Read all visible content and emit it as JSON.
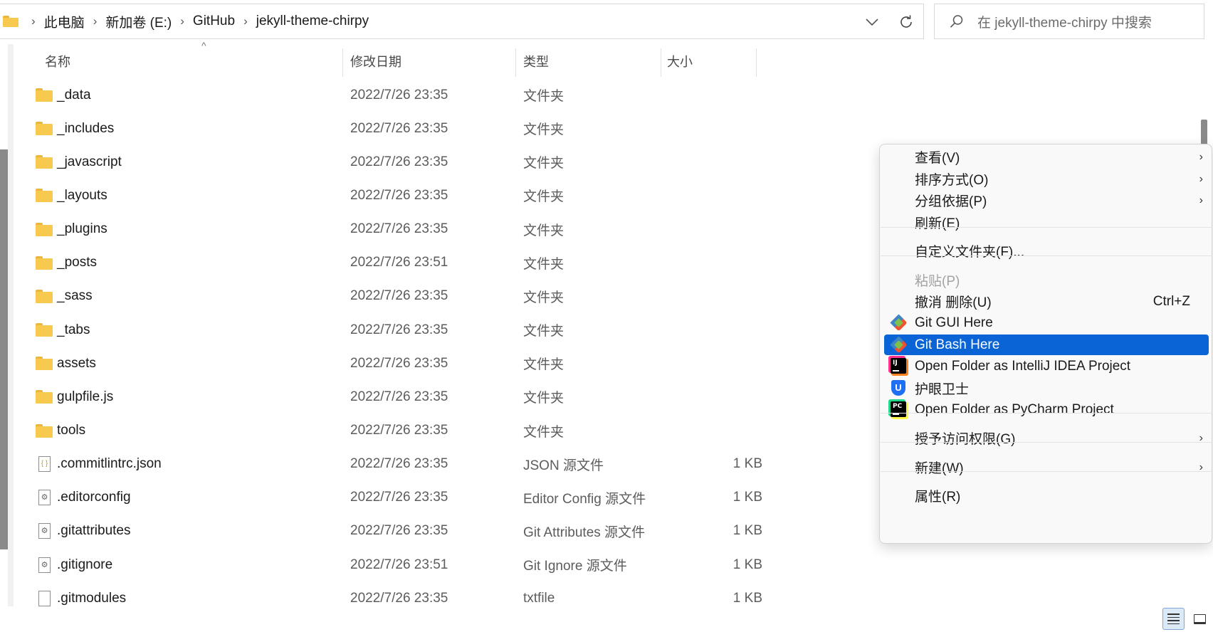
{
  "address_bar": {
    "crumbs": [
      "此电脑",
      "新加卷 (E:)",
      "GitHub",
      "jekyll-theme-chirpy"
    ],
    "separator": "›"
  },
  "search": {
    "placeholder": "在 jekyll-theme-chirpy 中搜索"
  },
  "columns": {
    "name": "名称",
    "date": "修改日期",
    "type": "类型",
    "size": "大小"
  },
  "files": [
    {
      "name": "_data",
      "date": "2022/7/26 23:35",
      "type": "文件夹",
      "size": "",
      "icon": "folder-icon"
    },
    {
      "name": "_includes",
      "date": "2022/7/26 23:35",
      "type": "文件夹",
      "size": "",
      "icon": "folder-icon"
    },
    {
      "name": "_javascript",
      "date": "2022/7/26 23:35",
      "type": "文件夹",
      "size": "",
      "icon": "folder-icon"
    },
    {
      "name": "_layouts",
      "date": "2022/7/26 23:35",
      "type": "文件夹",
      "size": "",
      "icon": "folder-icon"
    },
    {
      "name": "_plugins",
      "date": "2022/7/26 23:35",
      "type": "文件夹",
      "size": "",
      "icon": "folder-icon"
    },
    {
      "name": "_posts",
      "date": "2022/7/26 23:51",
      "type": "文件夹",
      "size": "",
      "icon": "folder-icon"
    },
    {
      "name": "_sass",
      "date": "2022/7/26 23:35",
      "type": "文件夹",
      "size": "",
      "icon": "folder-icon"
    },
    {
      "name": "_tabs",
      "date": "2022/7/26 23:35",
      "type": "文件夹",
      "size": "",
      "icon": "folder-icon"
    },
    {
      "name": "assets",
      "date": "2022/7/26 23:35",
      "type": "文件夹",
      "size": "",
      "icon": "folder-icon"
    },
    {
      "name": "gulpfile.js",
      "date": "2022/7/26 23:35",
      "type": "文件夹",
      "size": "",
      "icon": "folder-icon"
    },
    {
      "name": "tools",
      "date": "2022/7/26 23:35",
      "type": "文件夹",
      "size": "",
      "icon": "folder-icon"
    },
    {
      "name": ".commitlintrc.json",
      "date": "2022/7/26 23:35",
      "type": "JSON 源文件",
      "size": "1 KB",
      "icon": "json-file-icon"
    },
    {
      "name": ".editorconfig",
      "date": "2022/7/26 23:35",
      "type": "Editor Config 源文件",
      "size": "1 KB",
      "icon": "config-file-icon"
    },
    {
      "name": ".gitattributes",
      "date": "2022/7/26 23:35",
      "type": "Git Attributes 源文件",
      "size": "1 KB",
      "icon": "config-file-icon"
    },
    {
      "name": ".gitignore",
      "date": "2022/7/26 23:51",
      "type": "Git Ignore 源文件",
      "size": "1 KB",
      "icon": "config-file-icon"
    },
    {
      "name": ".gitmodules",
      "date": "2022/7/26 23:35",
      "type": "txtfile",
      "size": "1 KB",
      "icon": "text-file-icon"
    }
  ],
  "context_menu": {
    "items": [
      {
        "label": "查看(V)",
        "submenu": true
      },
      {
        "label": "排序方式(O)",
        "submenu": true
      },
      {
        "label": "分组依据(P)",
        "submenu": true
      },
      {
        "label": "刷新(E)"
      },
      {
        "label": "自定义文件夹(F)..."
      },
      {
        "label": "粘贴(P)",
        "disabled": true
      },
      {
        "label": "撤消 删除(U)",
        "shortcut": "Ctrl+Z"
      },
      {
        "label": "Git GUI Here",
        "icon": "git-icon"
      },
      {
        "label": "Git Bash Here",
        "icon": "git-icon",
        "highlighted": true
      },
      {
        "label": "Open Folder as IntelliJ IDEA Project",
        "icon": "intellij-icon",
        "icon_text": "IJ"
      },
      {
        "label": "护眼卫士",
        "icon": "eye-guard-icon",
        "icon_text": "U"
      },
      {
        "label": "Open Folder as PyCharm Project",
        "icon": "pycharm-icon",
        "icon_text": "PC"
      },
      {
        "label": "授予访问权限(G)",
        "submenu": true
      },
      {
        "label": "新建(W)",
        "submenu": true
      },
      {
        "label": "属性(R)"
      }
    ],
    "submenu_glyph": "›",
    "highlight_color": "#0a64d6"
  },
  "glyphs": {
    "sort": "^",
    "dropdown": "∨",
    "json": "{ }",
    "gear": "⚙"
  }
}
